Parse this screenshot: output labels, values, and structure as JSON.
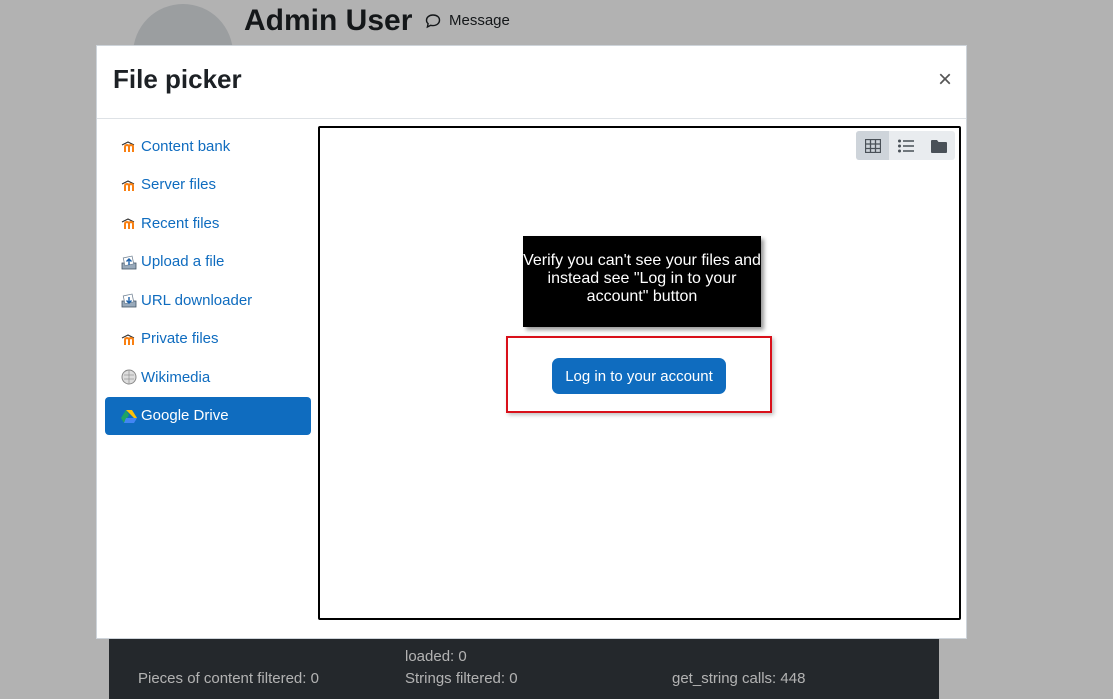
{
  "background": {
    "user_name": "Admin User",
    "message_label": "Message",
    "footer": {
      "loaded": "loaded: 0",
      "pieces_filtered": "Pieces of content filtered: 0",
      "strings_filtered": "Strings filtered: 0",
      "get_string_calls": "get_string calls: 448"
    }
  },
  "modal": {
    "title": "File picker",
    "close_label": "×",
    "repositories": [
      {
        "label": "Content bank",
        "icon": "moodle-icon",
        "active": false
      },
      {
        "label": "Server files",
        "icon": "moodle-icon",
        "active": false
      },
      {
        "label": "Recent files",
        "icon": "moodle-icon",
        "active": false
      },
      {
        "label": "Upload a file",
        "icon": "upload-icon",
        "active": false
      },
      {
        "label": "URL downloader",
        "icon": "download-icon",
        "active": false
      },
      {
        "label": "Private files",
        "icon": "moodle-icon",
        "active": false
      },
      {
        "label": "Wikimedia",
        "icon": "wikimedia-icon",
        "active": false
      },
      {
        "label": "Google Drive",
        "icon": "google-drive-icon",
        "active": true
      }
    ],
    "view_modes": [
      "grid-icon",
      "list-icon",
      "folder-icon"
    ],
    "annotation": "Verify you can't see your files and instead see \"Log in to your account\" button",
    "login_button": "Log in to your account"
  },
  "colors": {
    "accent": "#0f6cbf",
    "highlight": "#d9101a",
    "footer_bg": "#343a40"
  }
}
